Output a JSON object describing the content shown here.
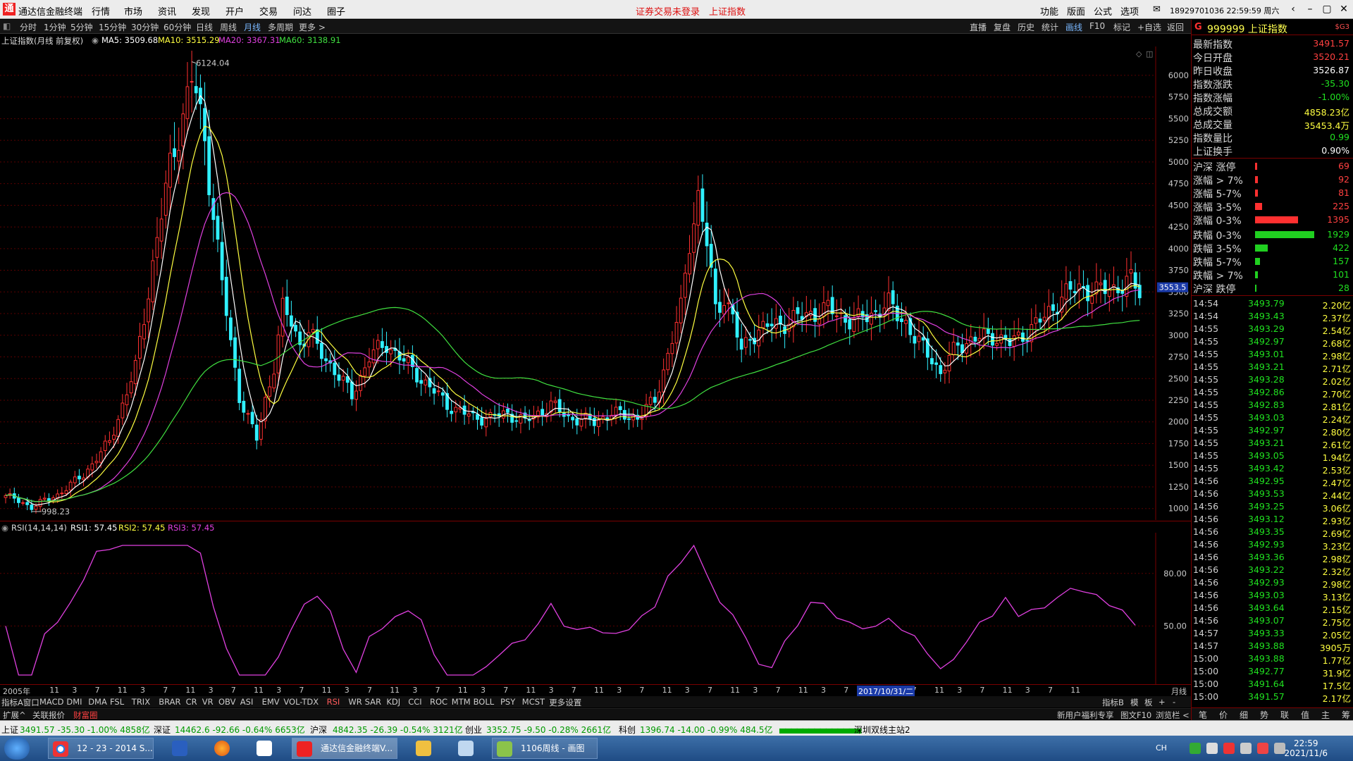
{
  "window": {
    "app_name": "通达信金融终端",
    "menus": [
      "行情",
      "市场",
      "资讯",
      "发现",
      "开户",
      "交易",
      "问达",
      "圈子"
    ],
    "alerts": [
      "证券交易未登录",
      "上证指数"
    ],
    "right_menus": [
      "功能",
      "版面",
      "公式",
      "选项"
    ],
    "account": "18929701036 22:59:59 周六",
    "logo": "通"
  },
  "toolbar": {
    "periods": [
      "分时",
      "1分钟",
      "5分钟",
      "15分钟",
      "30分钟",
      "60分钟",
      "日线",
      "周线",
      "月线",
      "多周期",
      "更多 >"
    ],
    "active": "月线",
    "right": [
      "直播",
      "复盘",
      "历史",
      "统计",
      "画线",
      "F10",
      "标记",
      "+自选",
      "返回"
    ]
  },
  "info": {
    "title": "上证指数(月线 前复权)",
    "ma5": "MA5: 3509.68",
    "ma10": "MA10: 3515.29",
    "ma20": "MA20: 3367.31",
    "ma60": "MA60: 3138.91"
  },
  "chart": {
    "high_label": "6124.04",
    "low_label": "998.23",
    "price_tag": "3553.5",
    "y_ticks": [
      "6000",
      "5750",
      "5500",
      "5250",
      "5000",
      "4750",
      "4500",
      "4250",
      "4000",
      "3750",
      "3500",
      "3250",
      "3000",
      "2750",
      "2500",
      "2250",
      "2000",
      "1750",
      "1500",
      "1250",
      "1000"
    ],
    "rsi_title": "RSI(14,14,14)",
    "rsi1": "RSI1: 57.45",
    "rsi2": "RSI2: 57.45",
    "rsi3": "RSI3: 57.45",
    "rsi_ticks": [
      "80.00",
      "50.00"
    ]
  },
  "chart_data": {
    "type": "candlestick",
    "title": "上证指数(月线 前复权)",
    "ylim": [
      900,
      6300
    ],
    "up_color": "#ff3030",
    "down_color": "#30f0ff",
    "extremes": {
      "high": 6124.04,
      "low": 998.23
    }
  },
  "xaxis": {
    "labels": [
      "2005年",
      "11",
      "3",
      "7",
      "11",
      "3",
      "7",
      "11",
      "3",
      "7",
      "11",
      "3",
      "7",
      "11",
      "3",
      "7",
      "11",
      "3",
      "7",
      "11",
      "3",
      "7",
      "11",
      "3",
      "7",
      "11",
      "3",
      "7",
      "11",
      "3",
      "7",
      "11",
      "3",
      "7",
      "11",
      "3",
      "7",
      "11",
      "3",
      "7",
      "11",
      "3",
      "7",
      "11",
      "3",
      "7",
      "11"
    ],
    "highlight": "2017/10/31/二",
    "period": "月线"
  },
  "indicator_tabs": [
    "指标A",
    "窗口",
    "MACD",
    "DMI",
    "DMA",
    "FSL",
    "TRIX",
    "BRAR",
    "CR",
    "VR",
    "OBV",
    "ASI",
    "EMV",
    "VOL-TDX",
    "RSI",
    "WR",
    "SAR",
    "KDJ",
    "CCI",
    "ROC",
    "MTM",
    "BOLL",
    "PSY",
    "MCST",
    "更多",
    "设置"
  ],
  "indicator_right": [
    "指标B",
    "模",
    "板",
    "+",
    "-"
  ],
  "ext_tabs": [
    "扩展^",
    "关联报价",
    "财富圈"
  ],
  "ext_right": [
    "新用户福利专享",
    "图文F10",
    "浏览栏 <"
  ],
  "right_panel": {
    "code": "999999 上证指数",
    "flag": "G",
    "badge": "$G3",
    "quotes": [
      {
        "k": "最新指数",
        "v": "3491.57",
        "c": "up"
      },
      {
        "k": "今日开盘",
        "v": "3520.21",
        "c": "up"
      },
      {
        "k": "昨日收盘",
        "v": "3526.87",
        "c": "wh"
      },
      {
        "k": "指数涨跌",
        "v": "-35.30",
        "c": "dn"
      },
      {
        "k": "指数涨幅",
        "v": "-1.00%",
        "c": "dn"
      },
      {
        "k": "总成交额",
        "v": "4858.23亿",
        "c": "ye"
      },
      {
        "k": "总成交量",
        "v": "35453.4万",
        "c": "ye"
      },
      {
        "k": "指数量比",
        "v": "0.99",
        "c": "dn"
      },
      {
        "k": "上证换手",
        "v": "0.90%",
        "c": "wh"
      }
    ],
    "stats": [
      {
        "k": "沪深 涨停",
        "v": "69",
        "c": "up",
        "n": 69
      },
      {
        "k": "涨幅 > 7%",
        "v": "92",
        "c": "up",
        "n": 92
      },
      {
        "k": "涨幅 5-7%",
        "v": "81",
        "c": "up",
        "n": 81
      },
      {
        "k": "涨幅 3-5%",
        "v": "225",
        "c": "up",
        "n": 225
      },
      {
        "k": "涨幅 0-3%",
        "v": "1395",
        "c": "up",
        "n": 1395
      },
      {
        "k": "跌幅 0-3%",
        "v": "1929",
        "c": "dn",
        "n": 1929
      },
      {
        "k": "跌幅 3-5%",
        "v": "422",
        "c": "dn",
        "n": 422
      },
      {
        "k": "跌幅 5-7%",
        "v": "157",
        "c": "dn",
        "n": 157
      },
      {
        "k": "跌幅 > 7%",
        "v": "101",
        "c": "dn",
        "n": 101
      },
      {
        "k": "沪深 跌停",
        "v": "28",
        "c": "dn",
        "n": 28
      }
    ],
    "ticks": [
      [
        "14:54",
        "3493.79",
        "2.20亿"
      ],
      [
        "14:54",
        "3493.43",
        "2.37亿"
      ],
      [
        "14:55",
        "3493.29",
        "2.54亿"
      ],
      [
        "14:55",
        "3492.97",
        "2.68亿"
      ],
      [
        "14:55",
        "3493.01",
        "2.98亿"
      ],
      [
        "14:55",
        "3493.21",
        "2.71亿"
      ],
      [
        "14:55",
        "3493.28",
        "2.02亿"
      ],
      [
        "14:55",
        "3492.86",
        "2.70亿"
      ],
      [
        "14:55",
        "3492.83",
        "2.81亿"
      ],
      [
        "14:55",
        "3493.03",
        "2.24亿"
      ],
      [
        "14:55",
        "3492.97",
        "2.80亿"
      ],
      [
        "14:55",
        "3493.21",
        "2.61亿"
      ],
      [
        "14:55",
        "3493.05",
        "1.94亿"
      ],
      [
        "14:55",
        "3493.42",
        "2.53亿"
      ],
      [
        "14:56",
        "3492.95",
        "2.47亿"
      ],
      [
        "14:56",
        "3493.53",
        "2.44亿"
      ],
      [
        "14:56",
        "3493.25",
        "3.06亿"
      ],
      [
        "14:56",
        "3493.12",
        "2.93亿"
      ],
      [
        "14:56",
        "3493.35",
        "2.69亿"
      ],
      [
        "14:56",
        "3492.93",
        "3.23亿"
      ],
      [
        "14:56",
        "3493.36",
        "2.98亿"
      ],
      [
        "14:56",
        "3493.22",
        "2.32亿"
      ],
      [
        "14:56",
        "3492.93",
        "2.98亿"
      ],
      [
        "14:56",
        "3493.03",
        "3.13亿"
      ],
      [
        "14:56",
        "3493.64",
        "2.15亿"
      ],
      [
        "14:56",
        "3493.07",
        "2.75亿"
      ],
      [
        "14:57",
        "3493.33",
        "2.05亿"
      ],
      [
        "14:57",
        "3493.88",
        "3905万"
      ],
      [
        "15:00",
        "3493.88",
        "1.77亿"
      ],
      [
        "15:00",
        "3492.77",
        "31.9亿"
      ],
      [
        "15:00",
        "3491.64",
        "17.5亿"
      ],
      [
        "15:00",
        "3491.57",
        "2.17亿"
      ]
    ],
    "tabs": [
      "笔",
      "价",
      "细",
      "势",
      "联",
      "值",
      "主",
      "筹"
    ]
  },
  "statusbar": {
    "sh": "上证",
    "sh_v": "3491.57 -35.30 -1.00% 4858亿",
    "sz": "深证",
    "sz_v": "14462.6 -92.66 -0.64% 6653亿",
    "hs": "沪深",
    "hs_v": "4842.35 -26.39 -0.54% 3121亿",
    "cy": "创业",
    "cy_v": "3352.75 -9.50 -0.28% 2661亿",
    "kc": "科创",
    "kc_v": "1396.74 -14.00 -0.99% 484.5亿",
    "server": "深圳双线主站2"
  },
  "taskbar": {
    "items": [
      "12 - 23 - 2014 S...",
      "通达信金融终端V...",
      "1106周线 - 画图"
    ],
    "time": "22:59",
    "date": "2021/11/6",
    "ime": "CH"
  }
}
